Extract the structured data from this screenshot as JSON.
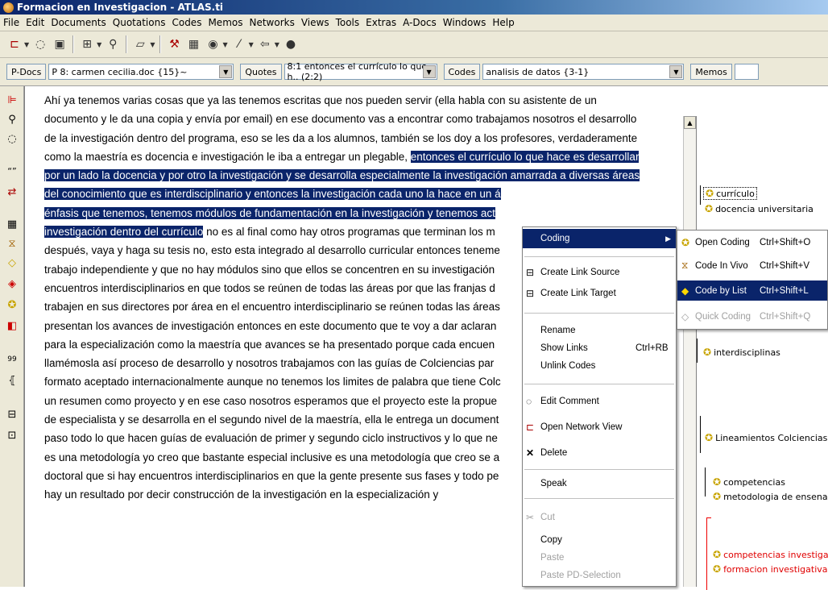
{
  "window": {
    "title": "Formacion en Investigacion - ATLAS.ti"
  },
  "menu": [
    "File",
    "Edit",
    "Documents",
    "Quotations",
    "Codes",
    "Memos",
    "Networks",
    "Views",
    "Tools",
    "Extras",
    "A-Docs",
    "Windows",
    "Help"
  ],
  "selectors": {
    "pdocs_label": "P-Docs",
    "pdocs_value": "P 8: carmen cecilia.doc {15}~",
    "quotes_label": "Quotes",
    "quotes_value": "8:1 entonces el currículo lo que h.. (2:2)",
    "codes_label": "Codes",
    "codes_value": "analisis de datos {3-1}",
    "memos_label": "Memos"
  },
  "document": {
    "lines": [
      {
        "pre": "Ahí ya tenemos varias cosas que ya las tenemos escritas que nos pueden servir (ella habla con su asistente de un",
        "hl": "",
        "post": ""
      },
      {
        "pre": "documento y le da una copia y envía por email) en ese documento vas a encontrar como trabajamos nosotros el desarrollo",
        "hl": "",
        "post": ""
      },
      {
        "pre": "de la investigación dentro del programa, eso se les da a los alumnos, también se los doy a los profesores, verdaderamente",
        "hl": "",
        "post": ""
      },
      {
        "pre": "como la maestría es docencia e investigación le iba a entregar un plegable, ",
        "hl": "entonces el currículo lo que hace es desarrollar",
        "post": ""
      },
      {
        "pre": "",
        "hl": "por un lado la docencia y por otro la investigación y se desarrolla especialmente la investigación amarrada a diversas áreas",
        "post": ""
      },
      {
        "pre": "",
        "hl": "del conocimiento que es interdisciplinario y entonces la investigación cada uno la hace en un á",
        "post": ""
      },
      {
        "pre": "",
        "hl": "énfasis que tenemos, tenemos módulos de fundamentación en la investigación y tenemos act",
        "post": ""
      },
      {
        "pre": "",
        "hl": "investigación dentro del currículo",
        "post": " no es al final como hay otros programas que terminan los m"
      },
      {
        "pre": "después, vaya y haga su tesis no, esto esta integrado al desarrollo curricular entonces teneme",
        "hl": "",
        "post": ""
      },
      {
        "pre": "trabajo independiente y que no hay módulos sino que ellos se concentren en su investigación",
        "hl": "",
        "post": ""
      },
      {
        "pre": "encuentros interdisciplinarios en que todos se reúnen de todas las áreas por que las franjas d",
        "hl": "",
        "post": ""
      },
      {
        "pre": "trabajen en sus directores por área en el encuentro interdisciplinario se reúnen todas las áreas",
        "hl": "",
        "post": ""
      },
      {
        "pre": "presentan los avances de investigación entonces en este documento que te voy a dar aclaran",
        "hl": "",
        "post": ""
      },
      {
        "pre": "para la especialización como la maestría que avances se ha presentado porque cada encuen",
        "hl": "",
        "post": ""
      },
      {
        "pre": "llamémosla así proceso de desarrollo y nosotros trabajamos con las guías de Colciencias par",
        "hl": "",
        "post": ""
      },
      {
        "pre": "formato aceptado internacionalmente aunque no tenemos los limites de palabra que tiene Colc",
        "hl": "",
        "post": ""
      },
      {
        "pre": "un resumen como proyecto y en ese caso nosotros esperamos que el proyecto este la propue",
        "hl": "",
        "post": ""
      },
      {
        "pre": "de especialista y se desarrolla en el segundo nivel de la maestría, ella le entrega un document",
        "hl": "",
        "post": ""
      },
      {
        "pre": "paso todo lo que hacen guías de evaluación de primer y segundo ciclo instructivos y lo que ne",
        "hl": "",
        "post": ""
      },
      {
        "pre": "es una metodología yo creo que bastante especial inclusive es una metodología que creo se a",
        "hl": "",
        "post": ""
      },
      {
        "pre": "doctoral que si hay encuentros interdisciplinarios en que la gente presente sus fases y todo pe",
        "hl": "",
        "post": ""
      },
      {
        "pre": "hay un resultado por decir construcción de la investigación en la especialización y",
        "hl": "",
        "post": ""
      }
    ]
  },
  "margin_codes": {
    "curriculo": "currículo",
    "docencia": "docencia universitaria",
    "interdisciplinas": "interdisciplinas",
    "lineamientos": "Lineamientos Colciencias",
    "competencias": "competencias",
    "metodologia": "metodologia de ensenanza",
    "comp_investigativas": "competencias investigativa",
    "formacion": "formacion investigativa",
    "colors": {
      "normal": "#000000",
      "red": "#e00000"
    }
  },
  "context_menu": {
    "coding": "Coding",
    "create_link_source": "Create Link Source",
    "create_link_target": "Create Link Target",
    "rename": "Rename",
    "show_links": "Show Links",
    "show_links_shortcut": "Ctrl+RB",
    "unlink_codes": "Unlink Codes",
    "edit_comment": "Edit Comment",
    "open_network_view": "Open Network View",
    "delete": "Delete",
    "speak": "Speak",
    "cut": "Cut",
    "copy": "Copy",
    "paste": "Paste",
    "paste_pd": "Paste PD-Selection"
  },
  "coding_submenu": {
    "open_coding": "Open Coding",
    "open_coding_sc": "Ctrl+Shift+O",
    "code_in_vivo": "Code In Vivo",
    "code_in_vivo_sc": "Ctrl+Shift+V",
    "code_by_list": "Code by List",
    "code_by_list_sc": "Ctrl+Shift+L",
    "quick_coding": "Quick Coding",
    "quick_coding_sc": "Ctrl+Shift+Q"
  }
}
